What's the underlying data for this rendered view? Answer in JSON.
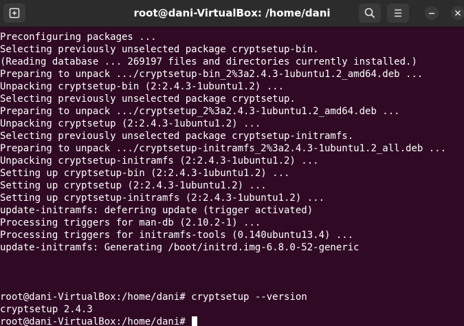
{
  "window": {
    "title": "root@dani-VirtualBox: /home/dani"
  },
  "toolbar": {
    "new_tab_icon": "new-tab-icon",
    "search_icon": "search-icon",
    "menu_icon": "hamburger-menu-icon",
    "minimize_icon": "minimize-icon",
    "close_icon": "close-icon"
  },
  "colors": {
    "terminal_background": "#300a24",
    "titlebar_background": "#2c2c2c",
    "text": "#ffffff"
  },
  "terminal": {
    "output_lines": [
      "Preconfiguring packages ...",
      "Selecting previously unselected package cryptsetup-bin.",
      "(Reading database ... 269197 files and directories currently installed.)",
      "Preparing to unpack .../cryptsetup-bin_2%3a2.4.3-1ubuntu1.2_amd64.deb ...",
      "Unpacking cryptsetup-bin (2:2.4.3-1ubuntu1.2) ...",
      "Selecting previously unselected package cryptsetup.",
      "Preparing to unpack .../cryptsetup_2%3a2.4.3-1ubuntu1.2_amd64.deb ...",
      "Unpacking cryptsetup (2:2.4.3-1ubuntu1.2) ...",
      "Selecting previously unselected package cryptsetup-initramfs.",
      "Preparing to unpack .../cryptsetup-initramfs_2%3a2.4.3-1ubuntu1.2_all.deb ...",
      "Unpacking cryptsetup-initramfs (2:2.4.3-1ubuntu1.2) ...",
      "Setting up cryptsetup-bin (2:2.4.3-1ubuntu1.2) ...",
      "Setting up cryptsetup (2:2.4.3-1ubuntu1.2) ...",
      "Setting up cryptsetup-initramfs (2:2.4.3-1ubuntu1.2) ...",
      "update-initramfs: deferring update (trigger activated)",
      "Processing triggers for man-db (2.10.2-1) ...",
      "Processing triggers for initramfs-tools (0.140ubuntu13.4) ...",
      "update-initramfs: Generating /boot/initrd.img-6.8.0-52-generic"
    ],
    "command_line": "root@dani-VirtualBox:/home/dani# cryptsetup --version",
    "version_output": "cryptsetup 2.4.3",
    "current_prompt": "root@dani-VirtualBox:/home/dani# "
  }
}
